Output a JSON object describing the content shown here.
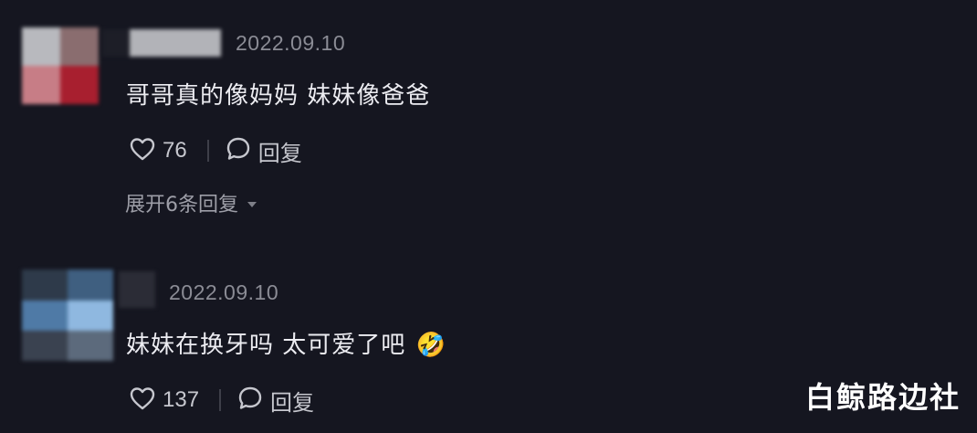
{
  "comments": [
    {
      "date": "2022.09.10",
      "text": "哥哥真的像妈妈 妹妹像爸爸",
      "likes": "76",
      "reply_label": "回复",
      "expand_label": "展开6条回复"
    },
    {
      "date": "2022.09.10",
      "text": "妹妹在换牙吗 太可爱了吧",
      "emoji": "🤣",
      "likes": "137",
      "reply_label": "回复"
    }
  ],
  "watermark": "白鲸路边社",
  "colors": {
    "background": "#151620",
    "text": "#ececf1",
    "muted": "#8b8c95"
  }
}
